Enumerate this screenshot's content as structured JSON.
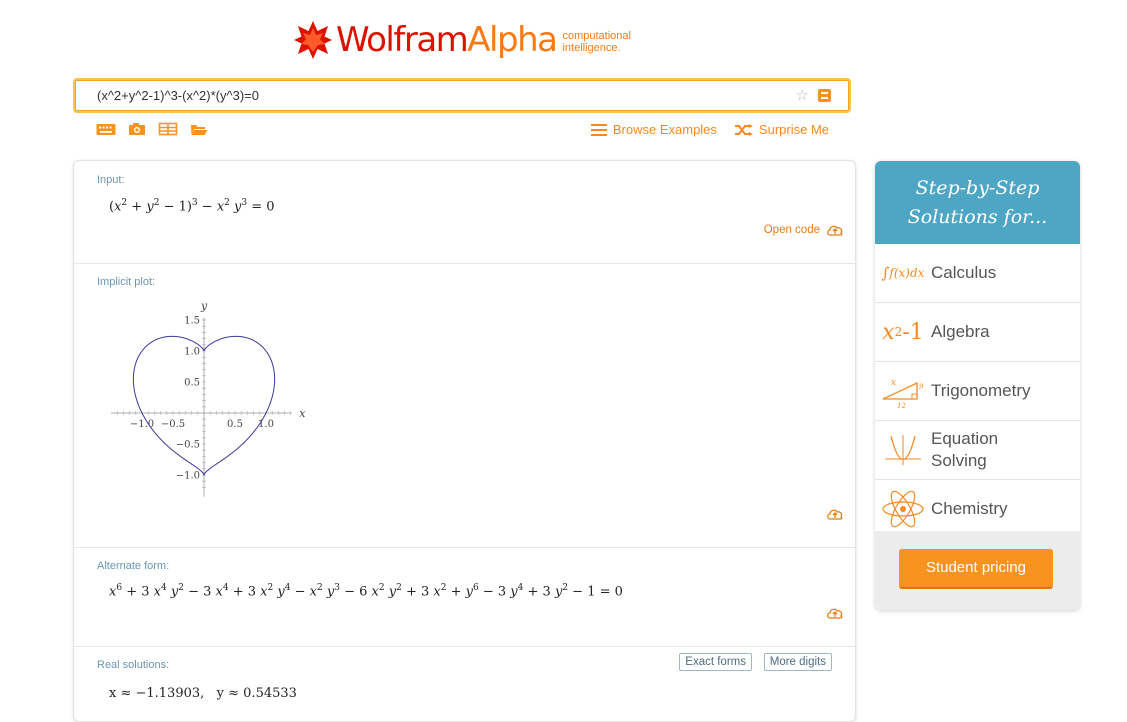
{
  "logo": {
    "word_part1": "Wolfram",
    "word_part2": "Alpha",
    "tagline_line1": "computational",
    "tagline_line2": "intelligence."
  },
  "search": {
    "query": "(x^2+y^2-1)^3-(x^2)*(y^3)=0",
    "star_icon": "star-icon",
    "go_icon": "equals-icon"
  },
  "toolbar": {
    "icons": [
      "keyboard-icon",
      "camera-icon",
      "table-icon",
      "folder-icon"
    ],
    "browse_label": "Browse Examples",
    "surprise_label": "Surprise Me"
  },
  "pods": {
    "input": {
      "title": "Input:",
      "action": "Open code"
    },
    "plot": {
      "title": "Implicit plot:"
    },
    "alternate": {
      "title": "Alternate form:"
    },
    "real": {
      "title": "Real solutions:",
      "btn_exact": "Exact forms",
      "btn_more": "More digits",
      "x_value": "x ≈ −1.13903",
      "y_value": "y ≈ 0.54533"
    }
  },
  "chart_data": {
    "type": "line",
    "title": "",
    "xlabel": "x",
    "ylabel": "y",
    "xlim": [
      -1.5,
      1.6
    ],
    "ylim": [
      -1.35,
      1.7
    ],
    "x_ticks": [
      "−1.0",
      "−0.5",
      "0.5",
      "1.0"
    ],
    "x_tick_values": [
      -1.0,
      -0.5,
      0.5,
      1.0
    ],
    "y_ticks": [
      "1.5",
      "1.0",
      "0.5",
      "−0.5",
      "−1.0"
    ],
    "y_tick_values": [
      1.5,
      1.0,
      0.5,
      -0.5,
      -1.0
    ],
    "curve_color": "#3a3a9a",
    "series": [
      {
        "equation": "(x^2+y^2-1)^3 - x^2*y^3 = 0"
      }
    ]
  },
  "sidebar": {
    "title_line1": "Step-by-Step",
    "title_line2": "Solutions for...",
    "items": [
      {
        "label": "Calculus",
        "icon": "integral-icon"
      },
      {
        "label": "Algebra",
        "icon": "x-squared-icon"
      },
      {
        "label": "Trigonometry",
        "icon": "triangle-icon"
      },
      {
        "label_line1": "Equation",
        "label_line2": "Solving",
        "icon": "parabola-icon"
      },
      {
        "label": "Chemistry",
        "icon": "atom-icon"
      }
    ],
    "student_label": "Student pricing"
  },
  "colors": {
    "brand_red": "#dd1100",
    "brand_orange": "#f7931e",
    "pod_title_blue": "#6b95b3",
    "sidebar_teal": "#4da6c3"
  }
}
